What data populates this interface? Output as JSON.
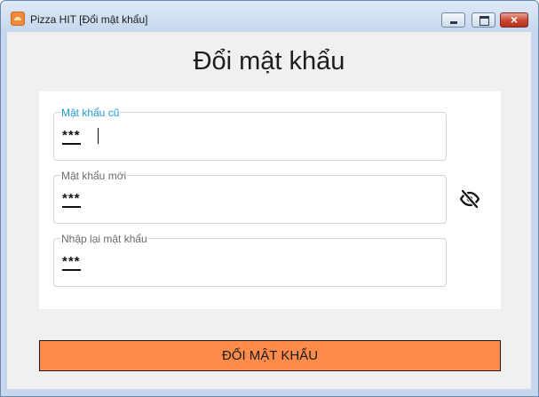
{
  "window": {
    "title": "Pizza HIT [Đổi mật khẩu]",
    "close_glyph": "×",
    "icons": {
      "app": "pizza-app-icon",
      "minimize": "minimize-icon",
      "maximize": "maximize-icon",
      "close": "close-icon"
    }
  },
  "form": {
    "heading": "Đổi mật khẩu",
    "fields": [
      {
        "label": "Mật khẩu cũ",
        "value": "***",
        "focused": true
      },
      {
        "label": "Mật khẩu mới",
        "value": "***"
      },
      {
        "label": "Nhập lại mật khẩu",
        "value": "***"
      }
    ],
    "toggle_icon": "eye-slash-icon",
    "submit_label": "ĐỔI MẬT KHẨU"
  },
  "colors": {
    "accent": "#ff8c4a",
    "focus_label": "#1f9ad6",
    "client_background": "#f0f0f0"
  }
}
